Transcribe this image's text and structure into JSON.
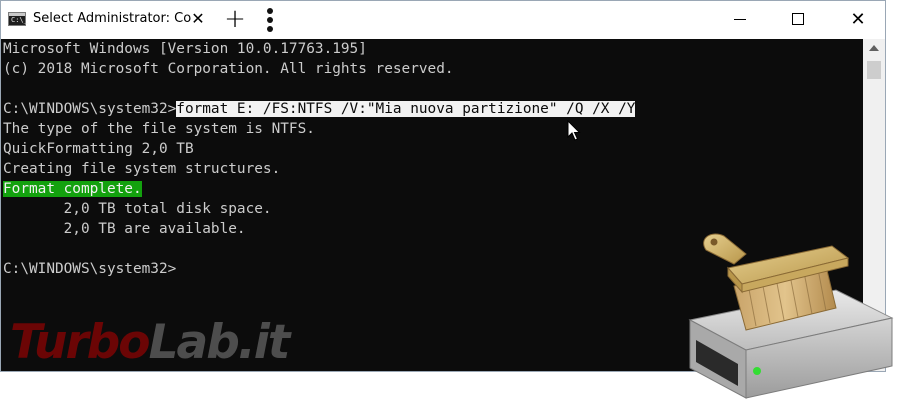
{
  "titlebar": {
    "tab_title": "Select Administrator: Co",
    "tab_icon_text": "C:\\_",
    "close_tab": "✕",
    "new_tab": "+",
    "close_window": "✕"
  },
  "console": {
    "lines": [
      "Microsoft Windows [Version 10.0.17763.195]",
      "(c) 2018 Microsoft Corporation. All rights reserved.",
      "",
      "C:\\WINDOWS\\system32>",
      "The type of the file system is NTFS.",
      "QuickFormatting 2,0 TB",
      "Creating file system structures.",
      "Format complete.",
      "       2,0 TB total disk space.",
      "       2,0 TB are available.",
      "",
      "C:\\WINDOWS\\system32>"
    ],
    "command": "format E: /FS:NTFS /V:\"Mia nuova partizione\" /Q /X /Y"
  },
  "watermark": {
    "part1": "Turbo",
    "part2": "Lab.it"
  },
  "colors": {
    "console_bg": "#0c0c0c",
    "console_fg": "#cccccc",
    "highlight_green": "#13a10e",
    "logo_red": "#b00000"
  },
  "icons": {
    "tab": "cmd-icon",
    "drive": "drive-format-brush-icon"
  }
}
